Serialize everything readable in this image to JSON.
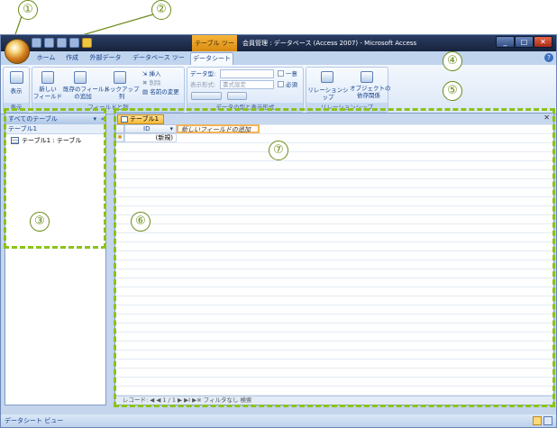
{
  "callouts": {
    "c1": "①",
    "c2": "②",
    "c3": "③",
    "c4": "④",
    "c5": "⑤",
    "c6": "⑥",
    "c7": "⑦"
  },
  "titlebar": {
    "context_tab": "テーブル ツール",
    "title": "会員管理 : データベース (Access 2007) - Microsoft Access",
    "minimize": "_",
    "maximize": "□",
    "close": "✕"
  },
  "tabs": [
    "ホーム",
    "作成",
    "外部データ",
    "データベース ツール",
    "データシート"
  ],
  "ribbon": {
    "groups": {
      "view": {
        "label": "表示",
        "button": "表示"
      },
      "fields": {
        "label": "フィールドと列",
        "new_field": "新しい\nフィールド",
        "existing_field": "既存のフィールド\nの追加",
        "lookup": "ルックアップ列",
        "insert": "挿入",
        "delete": "削除",
        "rename": "名前の変更"
      },
      "data_type": {
        "label": "データの型と表示形式",
        "type_label": "データ型:",
        "format_label": "表示形式:",
        "format_value": "書式設定",
        "unique": "一意",
        "required": "必須"
      },
      "relations": {
        "label": "リレーションシップ",
        "relationship": "リレーションシップ",
        "dependencies": "オブジェクトの\n依存関係"
      }
    }
  },
  "nav_pane": {
    "header": "すべてのテーブル",
    "group": "テーブル1",
    "item": "テーブル1 : テーブル"
  },
  "document": {
    "tab": "テーブル1",
    "columns": {
      "id": "ID",
      "new_field": "新しいフィールドの追加"
    },
    "new_row": "(新規)",
    "record_nav": "レコード: ◀ ◀ 1 / 1 ▶ ▶I ▶※    フィルタなし    検索"
  },
  "statusbar": {
    "text": "データシート ビュー"
  },
  "colors": {
    "callout_green": "#8cc21b",
    "callout_outline": "#6a8a18",
    "active_tab": "#f5b93a",
    "ribbon_text": "#15428b"
  }
}
